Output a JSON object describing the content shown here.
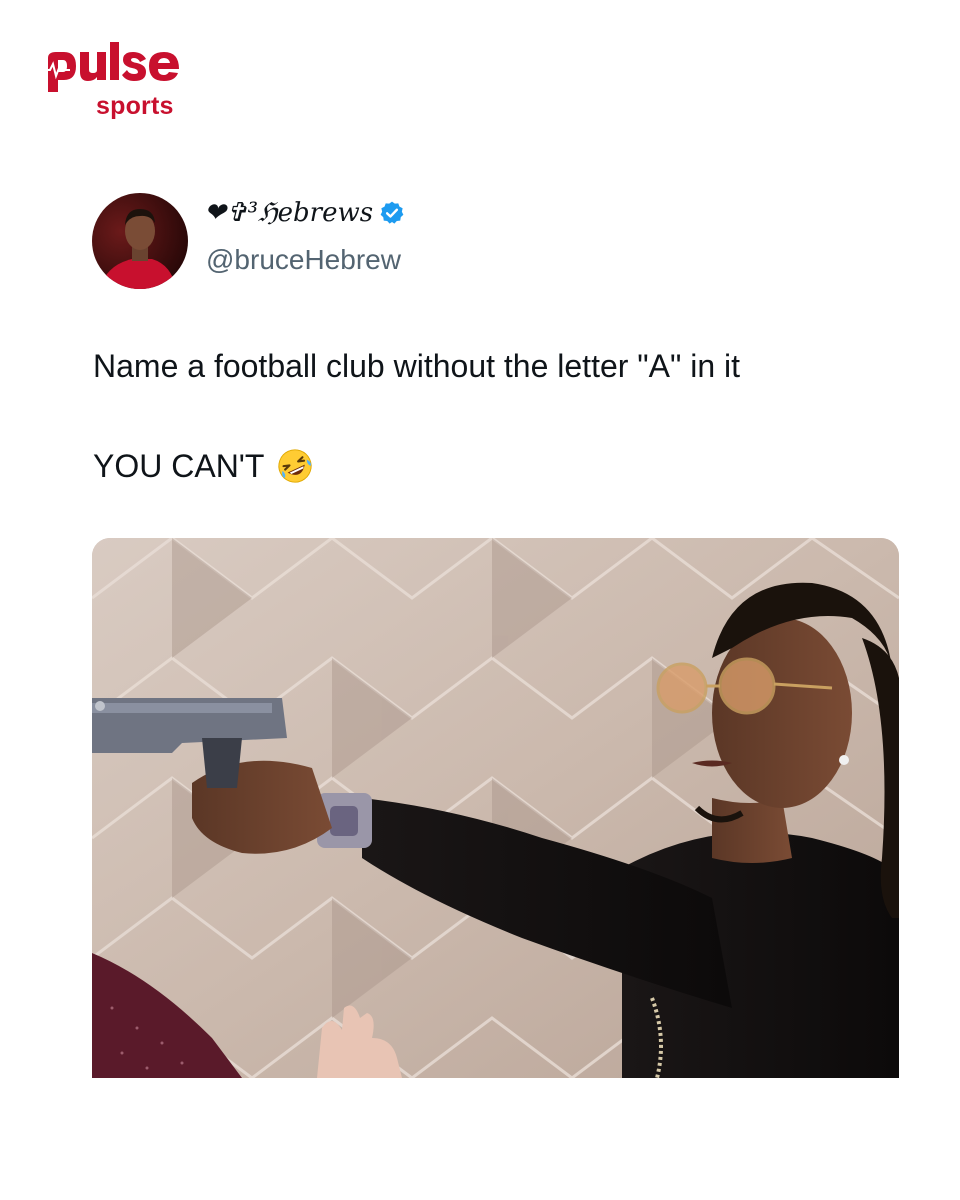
{
  "brand": {
    "name": "pulse",
    "subtitle": "sports",
    "color": "#c8102e"
  },
  "tweet": {
    "display_name": "❤✞³ℌebrews",
    "handle": "@bruceHebrew",
    "verified": true,
    "verified_icon": "verified-badge-icon",
    "text_line1": "Name a football club without the letter \"A\" in it",
    "text_line2": "YOU CAN'T",
    "emoji": "rolling-on-floor-laughing-emoji",
    "text_color": "#0f1419",
    "handle_color": "#536471",
    "verified_color": "#1d9bf0"
  },
  "media": {
    "type": "photo",
    "subject": "man-pointing-gun-image"
  }
}
